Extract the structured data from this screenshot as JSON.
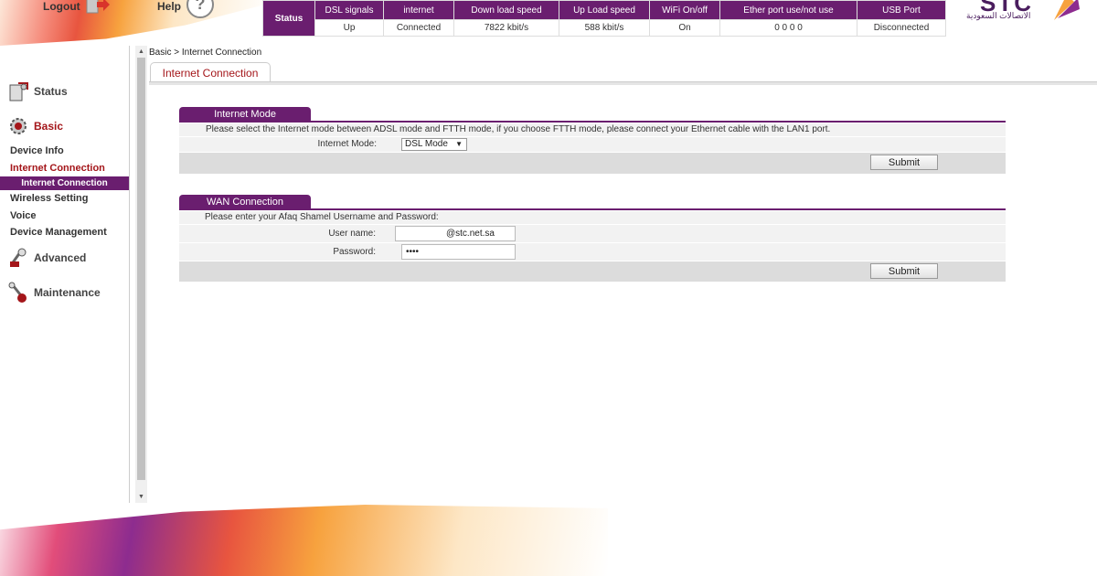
{
  "topnav": {
    "logout": "Logout",
    "help": "Help"
  },
  "status_table": {
    "label": "Status",
    "headers": [
      "DSL signals",
      "internet",
      "Down load speed",
      "Up Load speed",
      "WiFi On/off",
      "Ether port use/not use",
      "USB Port"
    ],
    "values": [
      "Up",
      "Connected",
      "7822 kbit/s",
      "588 kbit/s",
      "On",
      "0 0 0 0",
      "Disconnected"
    ]
  },
  "logo": {
    "en": "STC",
    "ar": "الاتصالات السعودية",
    "colors": {
      "brand": "#4a1d5e",
      "accent": "#6a1e6f"
    }
  },
  "sidebar": {
    "status": "Status",
    "basic": "Basic",
    "device_info": "Device Info",
    "internet_connection": "Internet Connection",
    "internet_connection_sub": "Internet Connection",
    "wireless_setting": "Wireless Setting",
    "voice": "Voice",
    "device_management": "Device Management",
    "advanced": "Advanced",
    "maintenance": "Maintenance"
  },
  "breadcrumb": "Basic > Internet Connection",
  "tab": "Internet Connection",
  "internet_mode": {
    "title": "Internet Mode",
    "message": "Please select the Internet mode between ADSL mode and FTTH mode, if you choose FTTH mode, please connect your Ethernet cable with the LAN1 port.",
    "mode_label": "Internet Mode:",
    "mode_value": "DSL Mode",
    "submit": "Submit"
  },
  "wan_connection": {
    "title": "WAN Connection",
    "message": "Please enter your Afaq Shamel Username and Password:",
    "username_label": "User name:",
    "username_suffix": "@stc.net.sa",
    "password_label": "Password:",
    "password_value": "••••",
    "submit": "Submit"
  }
}
